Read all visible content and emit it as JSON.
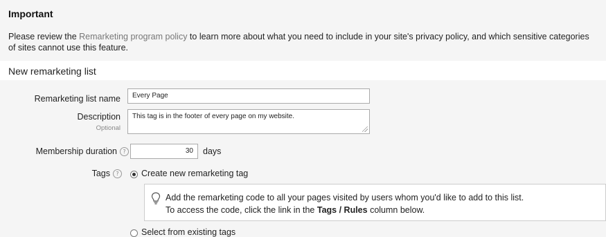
{
  "important": {
    "title": "Important",
    "text_prefix": "Please review the ",
    "link_label": "Remarketing program policy",
    "text_suffix": " to learn more about what you need to include in your site's privacy policy, and which sensitive categories of sites cannot use this feature."
  },
  "section_title": "New remarketing list",
  "form": {
    "list_name_label": "Remarketing list name",
    "list_name_value": "Every Page",
    "description_label": "Description",
    "description_optional": "Optional",
    "description_value": "This tag is in the footer of every page on my website.",
    "duration_label": "Membership duration",
    "duration_value": "30",
    "duration_unit": "days",
    "tags_label": "Tags",
    "help_glyph": "?",
    "create_tag_label": "Create new remarketing tag",
    "info_line1": "Add the remarketing code to all your pages visited by users whom you'd like to add to this list.",
    "info_line2_prefix": "To access the code, click the link in the ",
    "info_line2_bold": "Tags / Rules",
    "info_line2_suffix": " column below.",
    "select_existing_label": "Select from existing tags"
  }
}
